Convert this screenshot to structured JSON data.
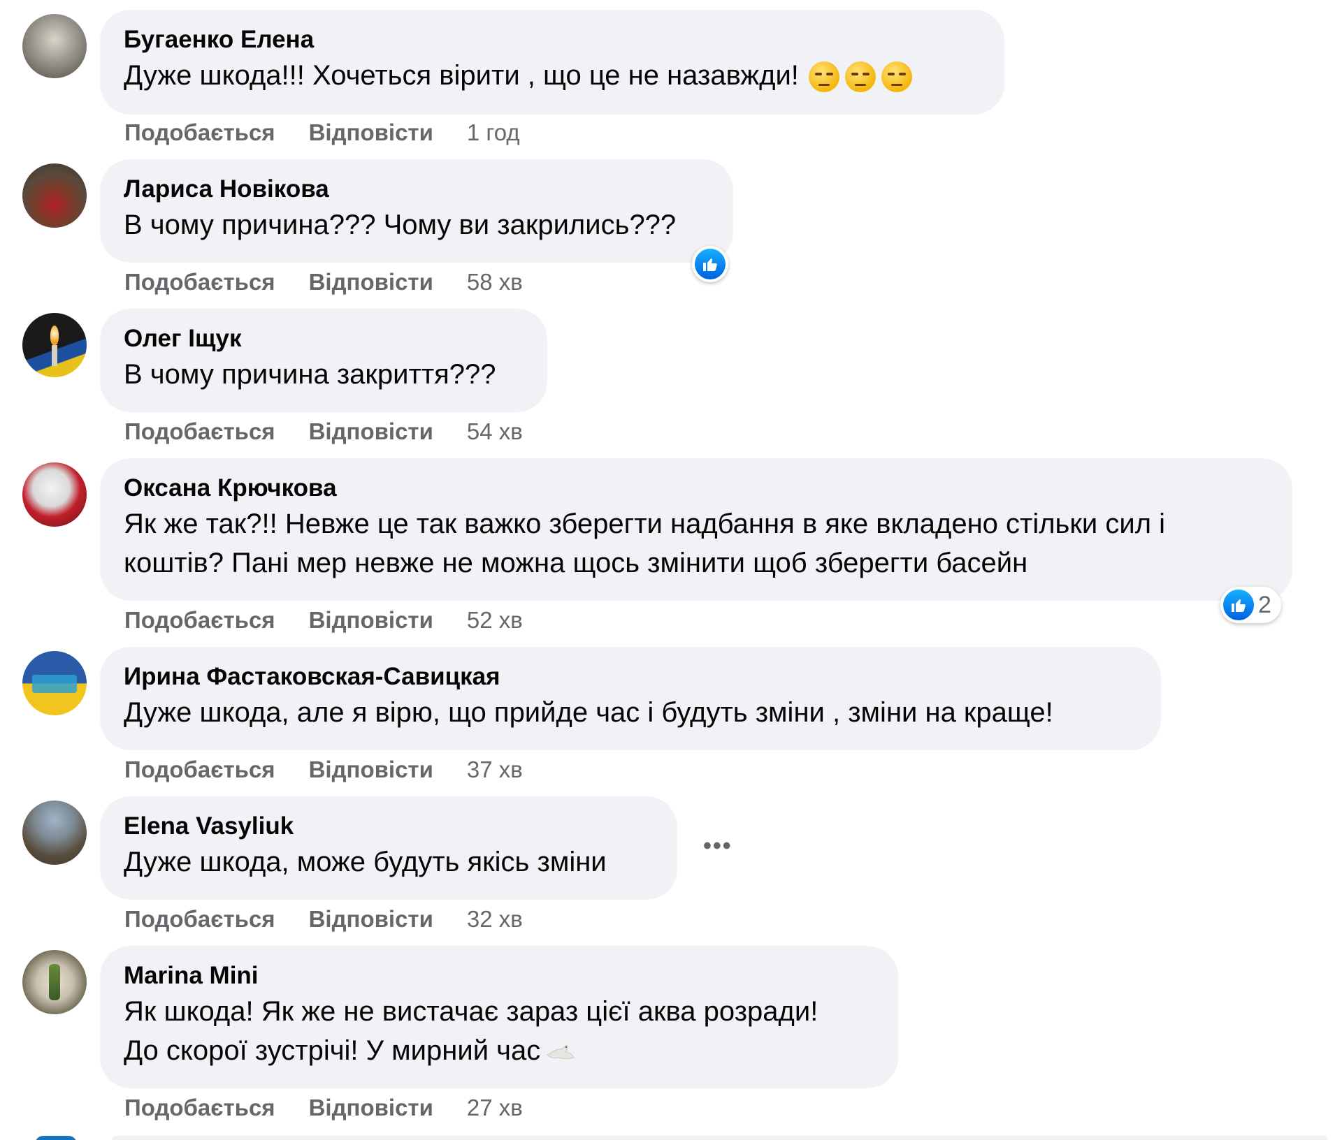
{
  "labels": {
    "like": "Подобається",
    "reply": "Відповісти"
  },
  "comments": [
    {
      "author": "Бугаенко Елена",
      "text": "Дуже шкода!!! Хочеться вірити , що це не назавжди!",
      "time": "1 год",
      "emojis": [
        "pensive-face",
        "pensive-face",
        "pensive-face"
      ]
    },
    {
      "author": "Лариса Новікова",
      "text": "В чому причина??? Чому ви закрились???",
      "time": "58 хв",
      "reaction": "like"
    },
    {
      "author": "Олег Іщук",
      "text": "В чому причина закриття???",
      "time": "54 хв"
    },
    {
      "author": "Оксана Крючкова",
      "text": "Як же так?!! Невже це так важко зберегти надбання в яке вкладено стільки сил і\nкоштів? Пані мер невже не можна щось змінити щоб зберегти басейн",
      "time": "52 хв",
      "reaction": "like",
      "reaction_count": "2"
    },
    {
      "author": "Ирина Фастаковская-Савицкая",
      "text": "Дуже шкода, але я вірю, що прийде час і будуть зміни , зміни на краще!",
      "time": "37 хв"
    },
    {
      "author": "Elena Vasyliuk",
      "text": "Дуже шкода, може будуть якісь зміни",
      "time": "32 хв",
      "more": "•••"
    },
    {
      "author": "Marina Mini",
      "text": "Як шкода! Як же не вистачає зараз цієї аква розради!\nДо скорої зустрічі! У мирний час",
      "time": "27 хв",
      "emojis": [
        "dove"
      ]
    }
  ],
  "colors": {
    "bubble": "#f0f2f5",
    "meta_text": "#65676b",
    "like_blue": "#0866ff"
  }
}
